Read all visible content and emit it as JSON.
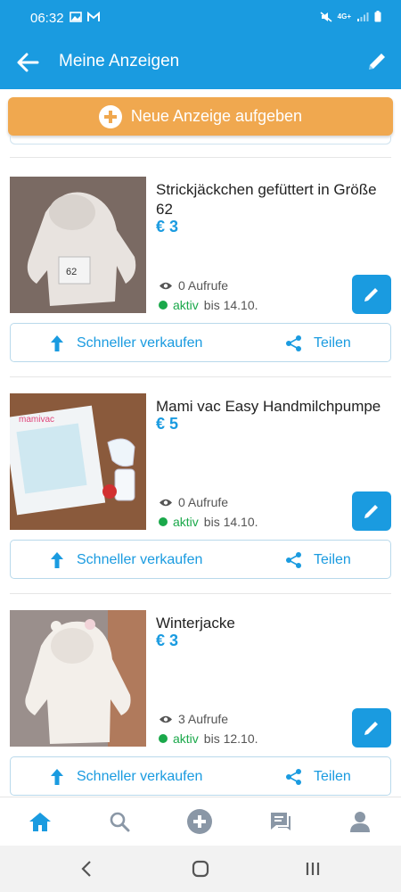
{
  "status": {
    "time": "06:32",
    "network": "4G+"
  },
  "appbar": {
    "title": "Meine Anzeigen"
  },
  "new_ad_button": {
    "label": "Neue Anzeige aufgeben"
  },
  "ads": [
    {
      "title": "Strickjäckchen gefüttert in Größe 62",
      "price": "€ 3",
      "views": "0 Aufrufe",
      "status": "aktiv",
      "until": "bis 14.10."
    },
    {
      "title": "Mami vac Easy Handmilchpumpe",
      "price": "€ 5",
      "views": "0 Aufrufe",
      "status": "aktiv",
      "until": "bis 14.10."
    },
    {
      "title": "Winterjacke",
      "price": "€ 3",
      "views": "3 Aufrufe",
      "status": "aktiv",
      "until": "bis 12.10."
    }
  ],
  "actions": {
    "sell_faster": "Schneller verkaufen",
    "share": "Teilen"
  },
  "bottom_nav": [
    "home-icon",
    "search-icon",
    "add-circle-icon",
    "messages-icon",
    "profile-icon"
  ],
  "colors": {
    "primary": "#1a9be0",
    "accent": "#f0a84f",
    "active": "#1aa84a",
    "nav_inactive": "#8a97a6"
  }
}
